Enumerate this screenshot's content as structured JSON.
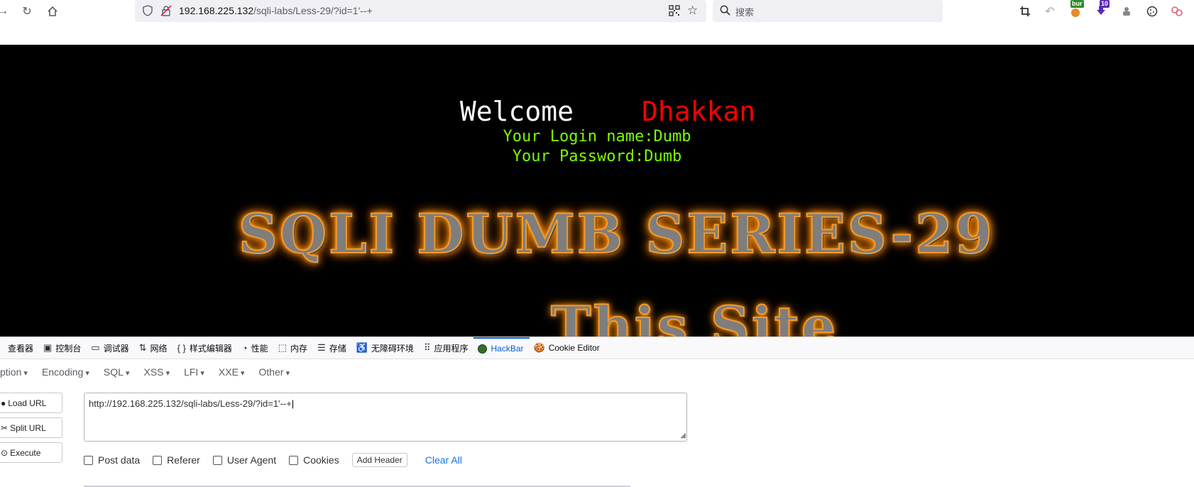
{
  "browser": {
    "url_host": "192.168.225.132",
    "url_path": "/sqli-labs/Less-29/?id=1'--+",
    "search_placeholder": "搜索",
    "extensions": [
      {
        "name": "burp-extension-icon",
        "badge": "bur"
      },
      {
        "name": "download-extension-icon",
        "badge": "10"
      }
    ]
  },
  "page": {
    "welcome_word": "Welcome",
    "welcome_name": "Dhakkan",
    "login_name": "Your Login name:Dumb",
    "password": "Your Password:Dumb",
    "banner": "SQLI DUMB SERIES-29",
    "banner2": "This Site"
  },
  "devtools": {
    "tabs": [
      {
        "label": "查看器",
        "icon": "inspector-icon",
        "active": false
      },
      {
        "label": "控制台",
        "icon": "console-icon",
        "active": false
      },
      {
        "label": "调试器",
        "icon": "debugger-icon",
        "active": false
      },
      {
        "label": "网络",
        "icon": "network-icon",
        "active": false
      },
      {
        "label": "样式编辑器",
        "icon": "style-editor-icon",
        "active": false
      },
      {
        "label": "性能",
        "icon": "performance-icon",
        "active": false
      },
      {
        "label": "内存",
        "icon": "memory-icon",
        "active": false
      },
      {
        "label": "存储",
        "icon": "storage-icon",
        "active": false
      },
      {
        "label": "无障碍环境",
        "icon": "accessibility-icon",
        "active": false
      },
      {
        "label": "应用程序",
        "icon": "application-icon",
        "active": false
      },
      {
        "label": "HackBar",
        "icon": "hackbar-icon",
        "active": true
      },
      {
        "label": "Cookie Editor",
        "icon": "cookie-icon",
        "active": false
      }
    ],
    "accent_color": "#0061e0"
  },
  "hackbar": {
    "menus": [
      "ption",
      "Encoding",
      "SQL",
      "XSS",
      "LFI",
      "XXE",
      "Other"
    ],
    "buttons": {
      "load_url": "Load URL",
      "split_url": "Split URL",
      "execute": "Execute"
    },
    "url_value": "http://192.168.225.132/sqli-labs/Less-29/?id=1'--+",
    "options": {
      "post_data": "Post data",
      "referer": "Referer",
      "user_agent": "User Agent",
      "cookies": "Cookies",
      "add_header": "Add Header",
      "clear_all": "Clear All"
    }
  }
}
